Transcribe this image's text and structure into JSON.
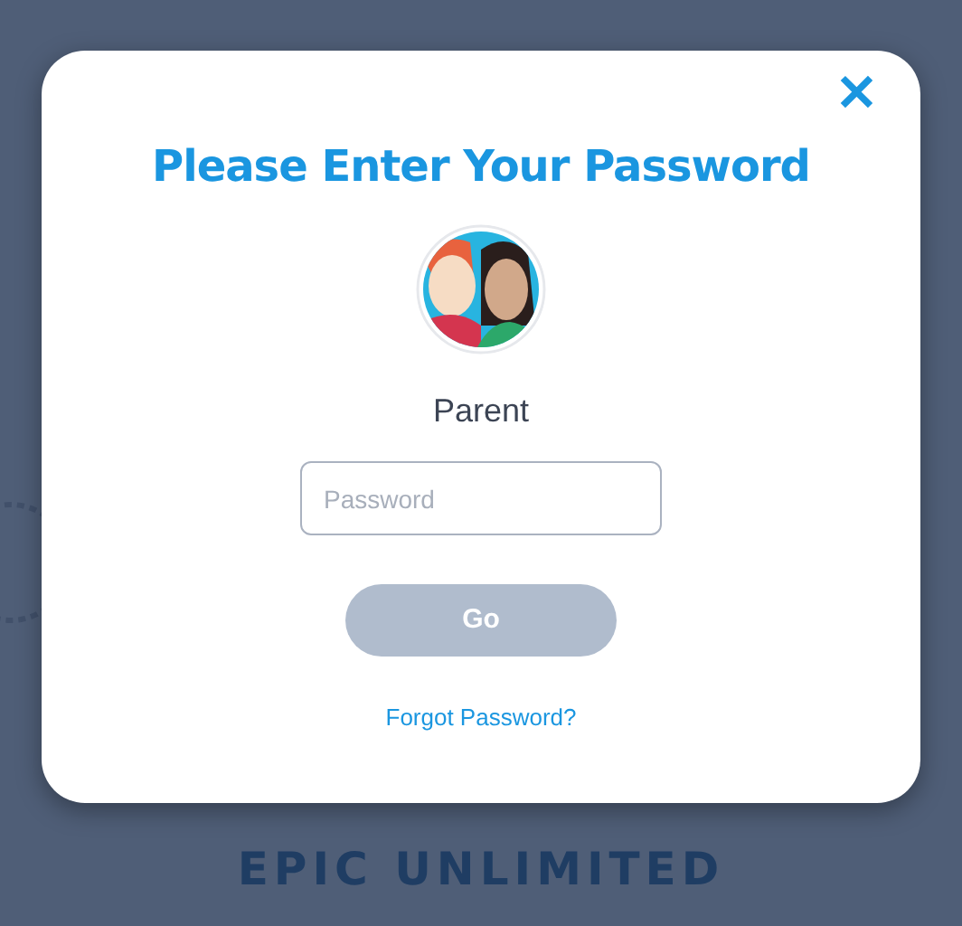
{
  "dialog": {
    "title": "Please Enter Your Password",
    "close": "✕",
    "user": {
      "name": "Parent"
    },
    "password": {
      "placeholder": "Password"
    },
    "go_button": {
      "label": "Go",
      "disabled": true
    },
    "forgot_link": "Forgot Password?"
  },
  "background": {
    "brand": "EPIC UNLIMITED"
  }
}
